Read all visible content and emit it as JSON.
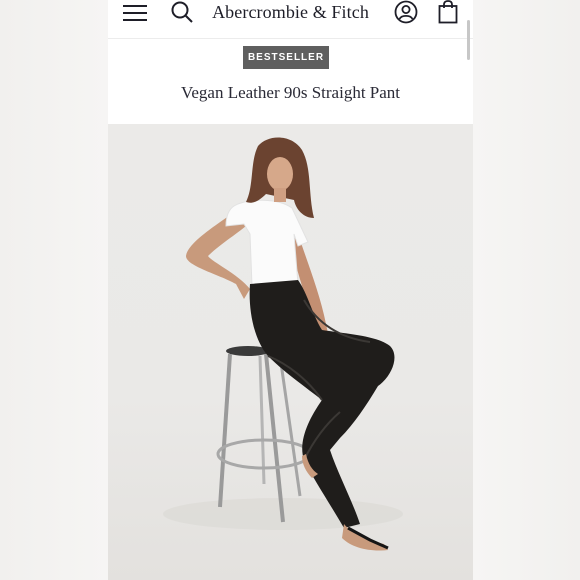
{
  "header": {
    "brand": "Abercrombie & Fitch",
    "icons": [
      "menu-icon",
      "search-icon",
      "account-icon",
      "shopping-bag-icon"
    ]
  },
  "product": {
    "badge": "BESTSELLER",
    "title": "Vegan Leather 90s Straight Pant"
  },
  "colors": {
    "badge_bg": "#5f5f5f",
    "text_dark": "#1e1e28",
    "photo_bg": "#ebeae8"
  }
}
